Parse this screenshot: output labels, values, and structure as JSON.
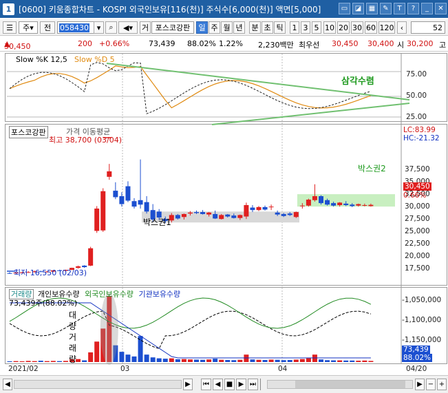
{
  "window": {
    "title": "[0600] 키움종합차트 - KOSPI 외국인보유[116(천)] 주식수[6,000(천)] 액면[5,000]",
    "badge": "1",
    "icons": [
      "minimize-window-icon",
      "pin-icon",
      "table-icon",
      "tools-icon",
      "settings-icon",
      "help-icon",
      "restore-icon",
      "close-icon"
    ]
  },
  "toolbar": {
    "period_select": "주",
    "prev_label": "전",
    "code_value": "058430",
    "search_label": "거",
    "stock_name": "포스코강판",
    "timeframes": [
      "일",
      "주",
      "월",
      "년",
      "분",
      "초",
      "틱"
    ],
    "active_timeframe": "일",
    "intervals": [
      "1",
      "3",
      "5",
      "10",
      "20",
      "30",
      "60",
      "120"
    ],
    "count_value": "52"
  },
  "quote": {
    "price": "30,450",
    "change": "200",
    "change_pct": "+0.66%",
    "volume": "73,439",
    "ratio": "88.02%",
    "turnover": "1.22%",
    "amount": "2,230백만",
    "quote_label": "최우선",
    "ask": "30,450",
    "bid": "30,400",
    "open_label": "시",
    "open": "30,200",
    "high_label": "고"
  },
  "stochastic": {
    "label_k": "Slow %K 12,5",
    "label_d": "Slow %D 5",
    "annotation": "삼각수렴",
    "axis": [
      "75.00",
      "50.00",
      "25.00"
    ]
  },
  "price_panel": {
    "legend_name": "포스코강판",
    "legend_ma": "가격 이동평균",
    "high_label": "최고 38,700 (03/04)",
    "low_label": "최저 16,550 (02/03)",
    "box1_label": "박스권1",
    "box2_label": "박스권2",
    "lc": "LC:83.99",
    "hc": "HC:-21.32",
    "axis": [
      "37,500",
      "35,000",
      "32,500",
      "30,000",
      "27,500",
      "25,000",
      "22,500",
      "20,000",
      "17,500"
    ],
    "last_price": "30,450",
    "last_pct": "0.66%"
  },
  "volume_panel": {
    "legends": [
      {
        "text": "거래량",
        "color": "#1a8a8a"
      },
      {
        "text": "개인보유수량",
        "color": "#000000"
      },
      {
        "text": "외국인보유수량",
        "color": "#208a20"
      },
      {
        "text": "기관보유수량",
        "color": "#1030c0"
      }
    ],
    "volume_info": "73,439주(88.02%)",
    "big_volume_label": "대량거래량",
    "axis": [
      "-1,050,000",
      "-1,100,000",
      "-1,150,000"
    ],
    "last_volume": "73,439",
    "last_pct": "88.02%"
  },
  "x_axis": {
    "labels": [
      "2021/02",
      "03",
      "04",
      "04/20"
    ]
  },
  "colors": {
    "up": "#e02020",
    "down": "#1c4fd0",
    "title_bar": "#1f5fa3",
    "box_fill": "#d8d8d8",
    "box2_fill": "#c8efc0",
    "trend_line": "#70c070"
  },
  "candles": [
    {
      "o": 16700,
      "h": 16900,
      "l": 16550,
      "c": 16650
    },
    {
      "o": 16650,
      "h": 16900,
      "l": 16600,
      "c": 16800
    },
    {
      "o": 16800,
      "h": 17000,
      "l": 16700,
      "c": 16850
    },
    {
      "o": 16850,
      "h": 17100,
      "l": 16750,
      "c": 16900
    },
    {
      "o": 16900,
      "h": 17200,
      "l": 16800,
      "c": 17050
    },
    {
      "o": 17050,
      "h": 17200,
      "l": 16900,
      "c": 16950
    },
    {
      "o": 16950,
      "h": 17100,
      "l": 16850,
      "c": 17000
    },
    {
      "o": 17000,
      "h": 17300,
      "l": 16900,
      "c": 17250
    },
    {
      "o": 17250,
      "h": 17400,
      "l": 17100,
      "c": 17150
    },
    {
      "o": 17150,
      "h": 17400,
      "l": 17050,
      "c": 17350
    },
    {
      "o": 17350,
      "h": 17800,
      "l": 17300,
      "c": 17750
    },
    {
      "o": 17750,
      "h": 18200,
      "l": 17600,
      "c": 18050
    },
    {
      "o": 18200,
      "h": 18300,
      "l": 17750,
      "c": 17900
    },
    {
      "o": 18200,
      "h": 22000,
      "l": 18100,
      "c": 21700
    },
    {
      "o": 25200,
      "h": 30200,
      "l": 24800,
      "c": 29700
    },
    {
      "o": 25300,
      "h": 33800,
      "l": 25000,
      "c": 33200
    },
    {
      "o": 36100,
      "h": 38700,
      "l": 35500,
      "c": 37200
    },
    {
      "o": 33300,
      "h": 35000,
      "l": 31600,
      "c": 32000
    },
    {
      "o": 32200,
      "h": 33000,
      "l": 30100,
      "c": 30600
    },
    {
      "o": 34200,
      "h": 35200,
      "l": 31000,
      "c": 31300
    },
    {
      "o": 31200,
      "h": 31800,
      "l": 29700,
      "c": 30100
    },
    {
      "o": 31400,
      "h": 39600,
      "l": 29700,
      "c": 30500
    },
    {
      "o": 31000,
      "h": 32200,
      "l": 28700,
      "c": 29100
    },
    {
      "o": 29400,
      "h": 30600,
      "l": 27100,
      "c": 27500
    },
    {
      "o": 29100,
      "h": 29600,
      "l": 27400,
      "c": 27900
    },
    {
      "o": 27600,
      "h": 28100,
      "l": 26800,
      "c": 27200
    },
    {
      "o": 27300,
      "h": 28800,
      "l": 26900,
      "c": 28400
    },
    {
      "o": 28400,
      "h": 28600,
      "l": 27500,
      "c": 27700
    },
    {
      "o": 28000,
      "h": 28700,
      "l": 27500,
      "c": 28600
    },
    {
      "o": 28700,
      "h": 29200,
      "l": 28300,
      "c": 28900
    },
    {
      "o": 29000,
      "h": 29300,
      "l": 28600,
      "c": 28800
    },
    {
      "o": 29000,
      "h": 29400,
      "l": 28500,
      "c": 28600
    },
    {
      "o": 28500,
      "h": 29000,
      "l": 28100,
      "c": 28900
    },
    {
      "o": 28600,
      "h": 29300,
      "l": 27600,
      "c": 27700
    },
    {
      "o": 27600,
      "h": 28600,
      "l": 27500,
      "c": 28400
    },
    {
      "o": 28500,
      "h": 28600,
      "l": 27900,
      "c": 28100
    },
    {
      "o": 28300,
      "h": 28700,
      "l": 27700,
      "c": 27800
    },
    {
      "o": 27800,
      "h": 28500,
      "l": 27400,
      "c": 28400
    },
    {
      "o": 28100,
      "h": 30900,
      "l": 27600,
      "c": 30400
    },
    {
      "o": 29900,
      "h": 30400,
      "l": 29000,
      "c": 29400
    },
    {
      "o": 29400,
      "h": 30200,
      "l": 29200,
      "c": 30000
    },
    {
      "o": 30000,
      "h": 30300,
      "l": 29300,
      "c": 29500
    },
    {
      "o": 30000,
      "h": 30500,
      "l": 29400,
      "c": 30100
    },
    {
      "o": 28900,
      "h": 29300,
      "l": 28200,
      "c": 28500
    },
    {
      "o": 28600,
      "h": 28800,
      "l": 28000,
      "c": 28200
    },
    {
      "o": 28700,
      "h": 29000,
      "l": 28200,
      "c": 28400
    },
    {
      "o": 28000,
      "h": 29100,
      "l": 27800,
      "c": 29000
    },
    {
      "o": 30200,
      "h": 30800,
      "l": 29700,
      "c": 30300
    },
    {
      "o": 30300,
      "h": 31700,
      "l": 30100,
      "c": 31500
    },
    {
      "o": 31400,
      "h": 34600,
      "l": 31100,
      "c": 32200
    },
    {
      "o": 32200,
      "h": 32400,
      "l": 30500,
      "c": 30800
    },
    {
      "o": 31400,
      "h": 31700,
      "l": 30300,
      "c": 30500
    },
    {
      "o": 30800,
      "h": 31100,
      "l": 30100,
      "c": 30300
    },
    {
      "o": 30400,
      "h": 31000,
      "l": 30100,
      "c": 30900
    },
    {
      "o": 30700,
      "h": 31200,
      "l": 30200,
      "c": 30400
    },
    {
      "o": 30500,
      "h": 30800,
      "l": 30000,
      "c": 30200
    },
    {
      "o": 30300,
      "h": 30700,
      "l": 30100,
      "c": 30600
    },
    {
      "o": 30400,
      "h": 30700,
      "l": 30150,
      "c": 30400
    },
    {
      "o": 30200,
      "h": 30700,
      "l": 30100,
      "c": 30450
    }
  ],
  "volumes": [
    4,
    5,
    4,
    6,
    5,
    7,
    5,
    6,
    5,
    6,
    14,
    16,
    9,
    52,
    110,
    180,
    360,
    90,
    55,
    40,
    30,
    140,
    40,
    25,
    20,
    18,
    20,
    15,
    16,
    14,
    13,
    12,
    14,
    18,
    12,
    11,
    10,
    12,
    40,
    14,
    12,
    11,
    13,
    12,
    10,
    11,
    13,
    16,
    20,
    40,
    14,
    10,
    9,
    9,
    8,
    8,
    7,
    8,
    6
  ]
}
